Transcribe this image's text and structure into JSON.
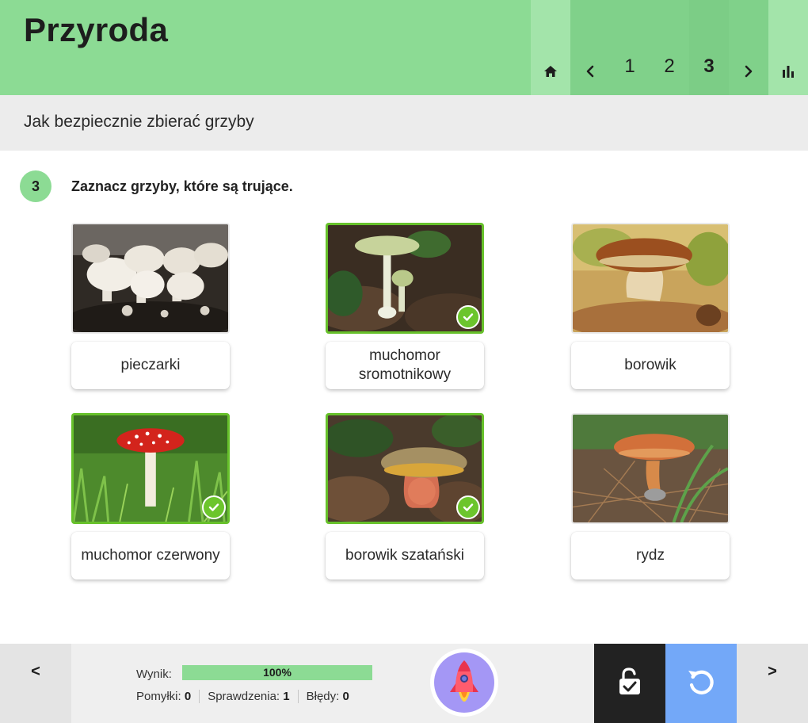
{
  "header": {
    "title": "Przyroda",
    "nav": {
      "home_icon": "home-icon",
      "prev_icon": "chevron-left-icon",
      "pages": [
        "1",
        "2",
        "3"
      ],
      "current_page": "3",
      "next_icon": "chevron-right-icon",
      "stats_icon": "bar-chart-icon"
    }
  },
  "lesson": {
    "title": "Jak bezpiecznie zbierać grzyby"
  },
  "question": {
    "number": "3",
    "text": "Zaznacz grzyby, które są trujące."
  },
  "cards": [
    {
      "label": "pieczarki",
      "selected": false
    },
    {
      "label": "muchomor sromotnikowy",
      "selected": true
    },
    {
      "label": "borowik",
      "selected": false
    },
    {
      "label": "muchomor czerwony",
      "selected": true
    },
    {
      "label": "borowik szatański",
      "selected": true
    },
    {
      "label": "rydz",
      "selected": false
    }
  ],
  "footer": {
    "prev_label": "<",
    "next_label": ">",
    "score_label": "Wynik:",
    "score_percent": "100%",
    "score_fraction": 1.0,
    "mistakes_label": "Pomyłki:",
    "mistakes_value": "0",
    "checks_label": "Sprawdzenia:",
    "checks_value": "1",
    "errors_label": "Błędy:",
    "errors_value": "0"
  },
  "colors": {
    "header_green": "#8cdb94",
    "selected_border": "#67c12b",
    "check_green": "#6cc52c",
    "reset_blue": "#73a8f8",
    "solution_dark": "#222222",
    "rocket_bg": "#a497f5"
  }
}
